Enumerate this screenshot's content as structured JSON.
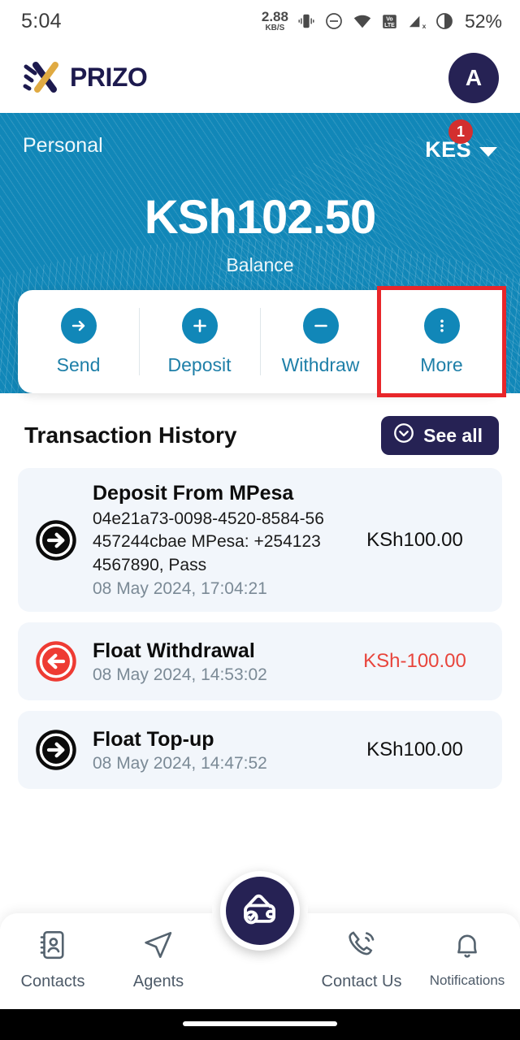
{
  "statusbar": {
    "time": "5:04",
    "net_speed_value": "2.88",
    "net_speed_unit": "KB/S",
    "battery": "52%",
    "icons": [
      "vibrate-icon",
      "do-not-disturb-icon",
      "wifi-icon",
      "volte-icon",
      "signal-off-icon",
      "moon-icon"
    ]
  },
  "header": {
    "brand": "PRIZO",
    "avatar_initial": "A"
  },
  "hero": {
    "account_type": "Personal",
    "currency": "KES",
    "currency_badge": "1",
    "balance": "KSh102.50",
    "balance_label": "Balance",
    "accent_color": "#1187b8"
  },
  "actions": [
    {
      "label": "Send",
      "icon": "arrow-right-icon"
    },
    {
      "label": "Deposit",
      "icon": "plus-icon"
    },
    {
      "label": "Withdraw",
      "icon": "minus-icon"
    },
    {
      "label": "More",
      "icon": "dots-vertical-icon"
    }
  ],
  "highlight_color": "#e8262a",
  "transactions_section": {
    "title": "Transaction History",
    "see_all_label": "See all"
  },
  "transactions": [
    {
      "name": "Deposit From MPesa",
      "description": "04e21a73-0098-4520-8584-56457244cbae\nMPesa: +2541234567890, Pass",
      "date": "08 May 2024, 17:04:21",
      "amount": "KSh100.00",
      "direction": "in",
      "icon": "arrow-right-circle-icon"
    },
    {
      "name": "Float Withdrawal",
      "description": "",
      "date": "08 May 2024, 14:53:02",
      "amount": "KSh-100.00",
      "direction": "out",
      "icon": "arrow-left-circle-icon"
    },
    {
      "name": "Float Top-up",
      "description": "",
      "date": "08 May 2024, 14:47:52",
      "amount": "KSh100.00",
      "direction": "in",
      "icon": "arrow-right-circle-icon"
    }
  ],
  "bottom_nav": [
    {
      "label": "Contacts",
      "icon": "contacts-book-icon"
    },
    {
      "label": "Agents",
      "icon": "paper-plane-icon"
    },
    {
      "label": "Contact Us",
      "icon": "phone-ring-icon"
    },
    {
      "label": "Notifications",
      "icon": "bell-icon"
    }
  ],
  "fab": {
    "icon": "wallet-check-icon",
    "color": "#262254"
  }
}
